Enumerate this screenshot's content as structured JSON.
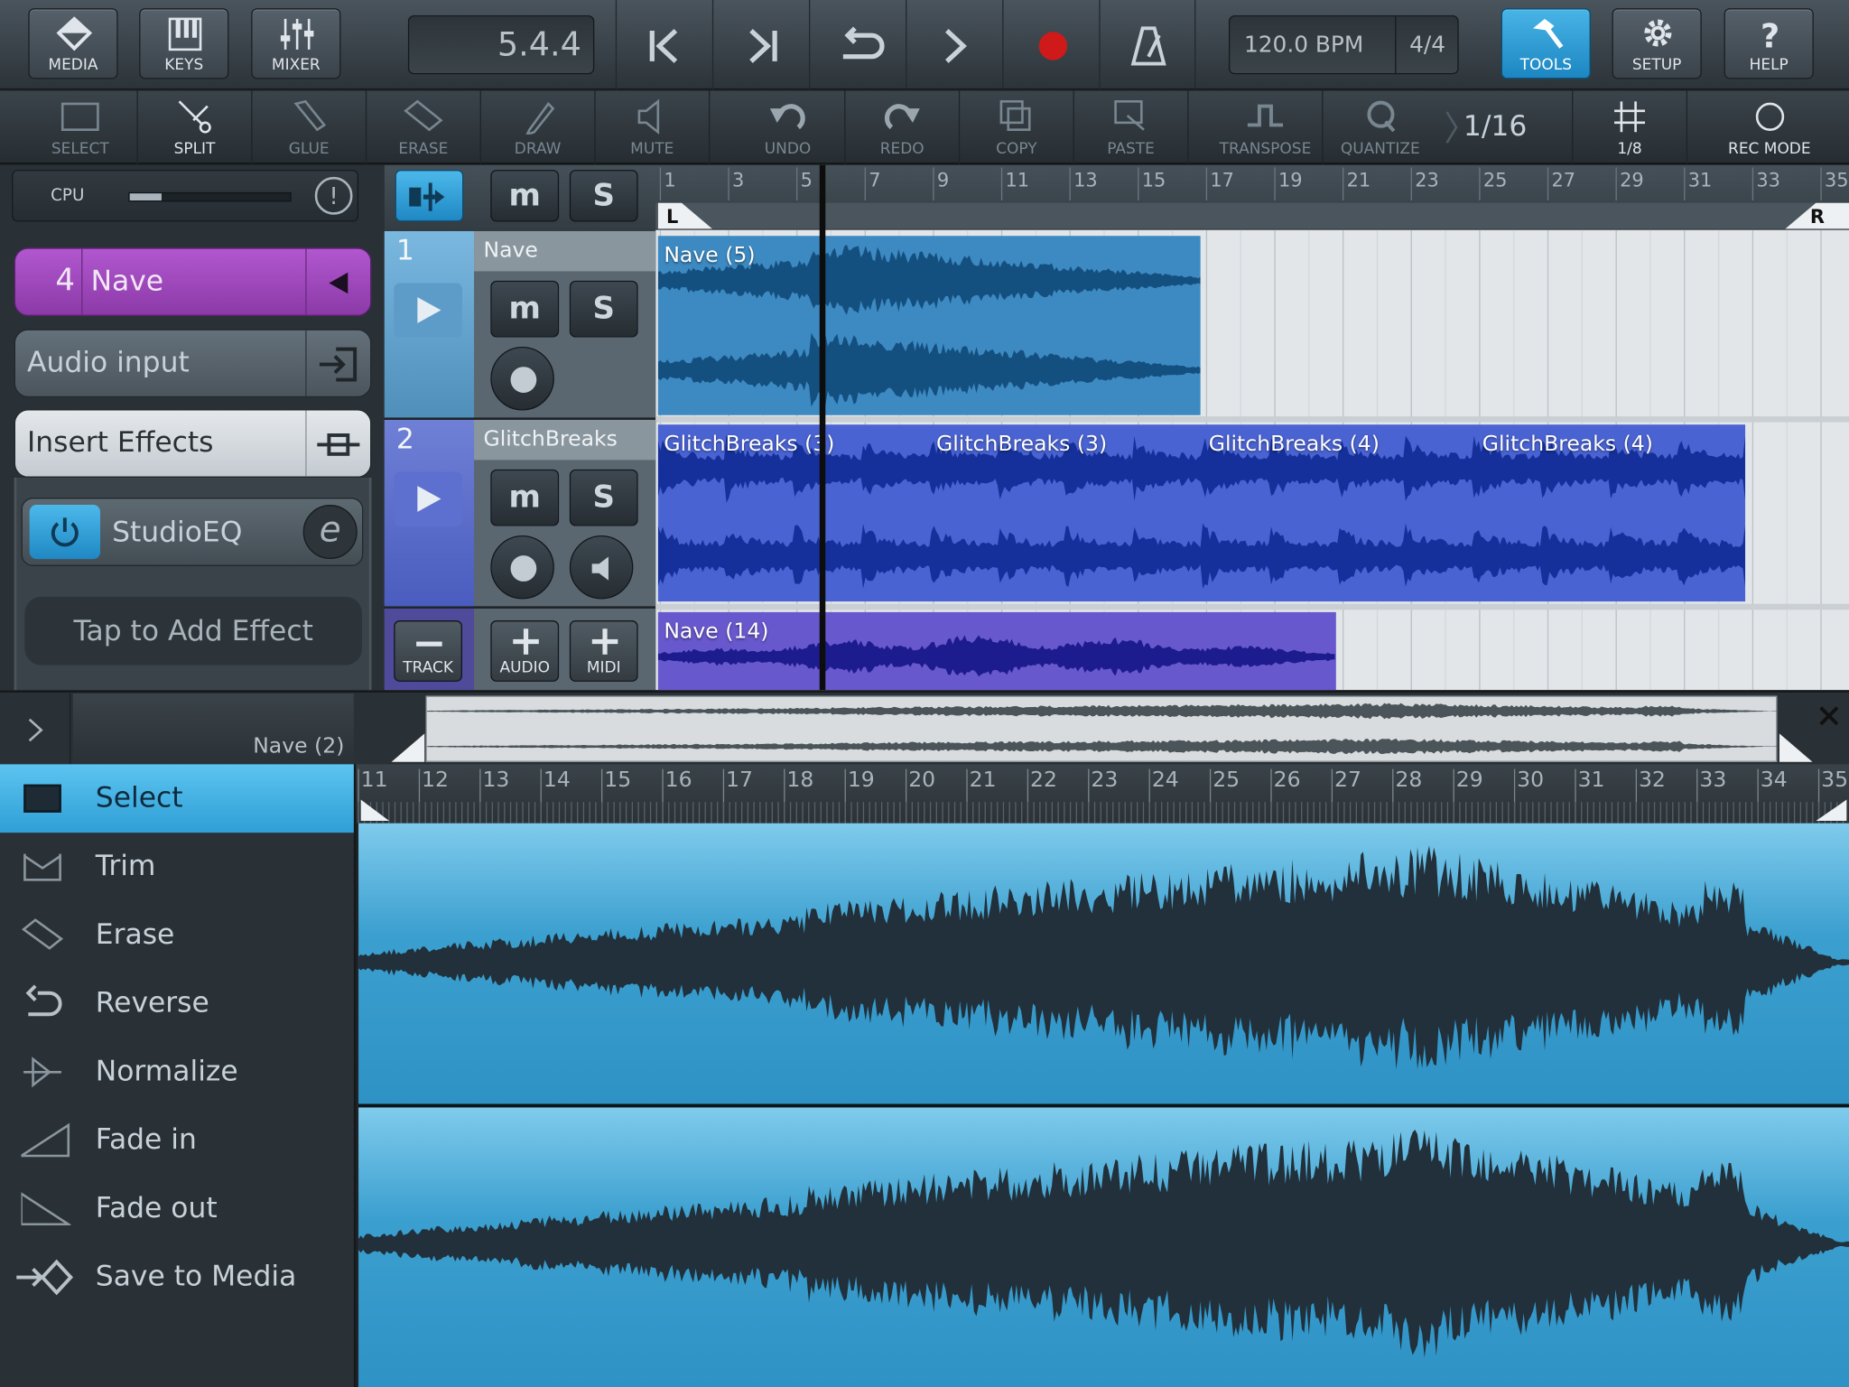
{
  "top_bar": {
    "buttons": {
      "media": "MEDIA",
      "keys": "KEYS",
      "mixer": "MIXER",
      "tools": "TOOLS",
      "setup": "SETUP",
      "help": "HELP"
    },
    "position": "5.4.4",
    "tempo": "120.0 BPM",
    "time_signature": "4/4"
  },
  "tool_bar": {
    "select": "SELECT",
    "split": "SPLIT",
    "glue": "GLUE",
    "erase": "ERASE",
    "draw": "DRAW",
    "mute": "MUTE",
    "undo": "UNDO",
    "redo": "REDO",
    "copy": "COPY",
    "paste": "PASTE",
    "transpose": "TRANSPOSE",
    "quantize": "QUANTIZE",
    "quantize_value": "1/16",
    "grid": "1/8",
    "rec_mode": "REC MODE"
  },
  "inspector": {
    "cpu_label": "CPU",
    "track_number": "4",
    "track_name": "Nave",
    "audio_input": "Audio input",
    "insert_effects": "Insert Effects",
    "effect_name": "StudioEQ",
    "add_effect": "Tap to Add Effect"
  },
  "arranger": {
    "ruler_top": [
      "1",
      "3",
      "5",
      "7",
      "9",
      "11",
      "13",
      "15",
      "17",
      "19",
      "21",
      "23",
      "25",
      "27",
      "29",
      "31",
      "33",
      "35"
    ],
    "locator_left": "L",
    "locator_right": "R",
    "tracks": [
      {
        "number": "1",
        "name": "Nave"
      },
      {
        "number": "2",
        "name": "GlitchBreaks"
      }
    ],
    "clips": {
      "t1": "Nave (5)",
      "t2a": "GlitchBreaks (3)",
      "t2b": "GlitchBreaks (3)",
      "t2c": "GlitchBreaks (4)",
      "t2d": "GlitchBreaks (4)",
      "t3": "Nave (14)"
    },
    "add_buttons": {
      "track": "TRACK",
      "audio": "AUDIO",
      "midi": "MIDI"
    }
  },
  "editor": {
    "clip_name": "Nave (2)",
    "ruler": [
      "11",
      "12",
      "13",
      "14",
      "15",
      "16",
      "17",
      "18",
      "19",
      "20",
      "21",
      "22",
      "23",
      "24",
      "25",
      "26",
      "27",
      "28",
      "29",
      "30",
      "31",
      "32",
      "33",
      "34",
      "35"
    ],
    "menu": [
      "Select",
      "Trim",
      "Erase",
      "Reverse",
      "Normalize",
      "Fade in",
      "Fade out",
      "Save to Media"
    ]
  },
  "colors": {
    "accent": "#3aa8dc",
    "track_purple": "#9944b4",
    "clip_blue": "#3a86c0",
    "clip_indigo": "#4a5ed0",
    "clip_violet": "#6656cc"
  }
}
